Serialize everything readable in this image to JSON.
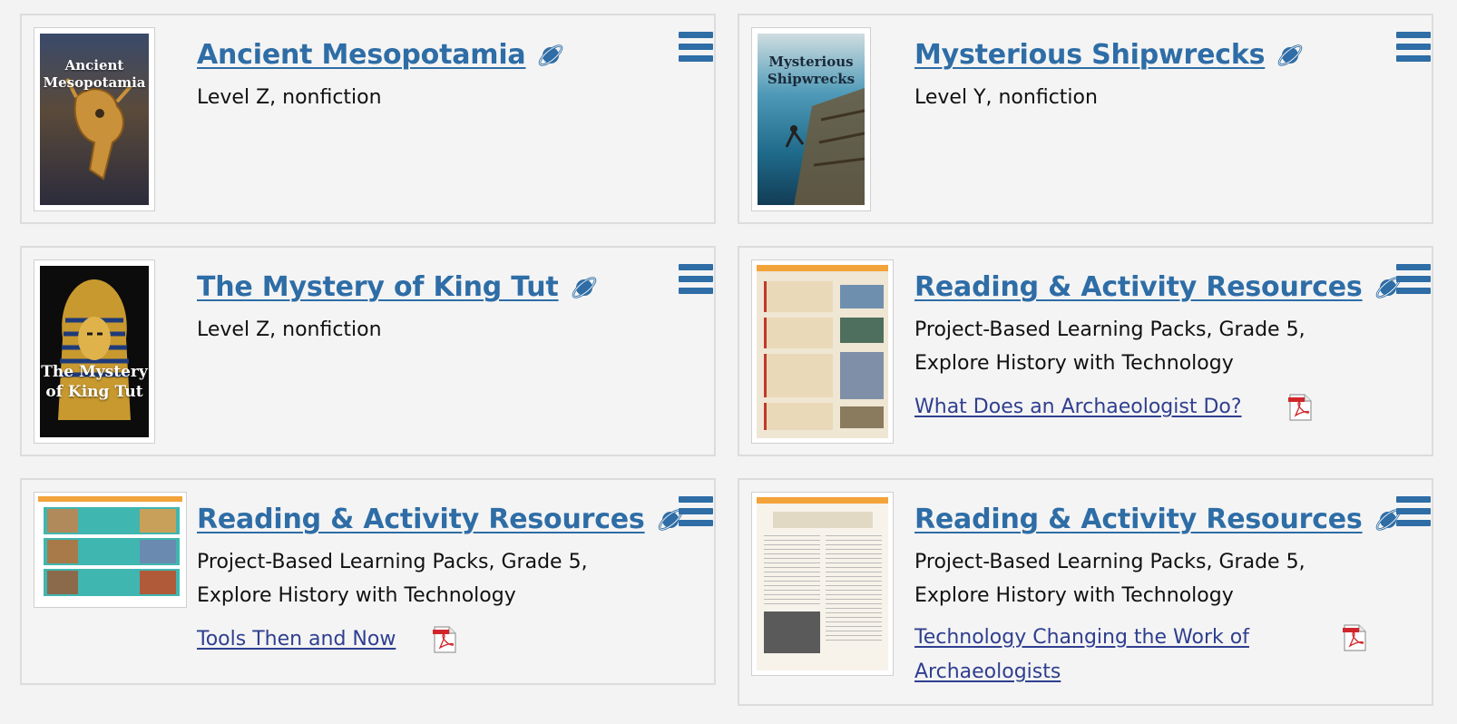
{
  "cards": [
    {
      "title": "Ancient Mesopotamia",
      "meta_line1": "Level Z, nonfiction",
      "cover_text": "Ancient Mesopotamia",
      "icons": {
        "explore": "planet-icon",
        "menu": "hamburger-menu-icon"
      }
    },
    {
      "title": "Mysterious Shipwrecks",
      "meta_line1": "Level Y, nonfiction",
      "cover_text": "Mysterious Shipwrecks",
      "icons": {
        "explore": "planet-icon",
        "menu": "hamburger-menu-icon"
      }
    },
    {
      "title": "The Mystery of King Tut",
      "meta_line1": "Level Z, nonfiction",
      "cover_text": "The Mystery of King Tut",
      "icons": {
        "explore": "planet-icon",
        "menu": "hamburger-menu-icon"
      }
    },
    {
      "title": "Reading & Activity Resources",
      "meta_line1": "Project-Based Learning Packs, Grade 5,",
      "meta_line2": "Explore History with Technology",
      "resource_link": "What Does an Archaeologist Do?",
      "icons": {
        "explore": "planet-icon",
        "menu": "hamburger-menu-icon",
        "file": "pdf-icon"
      }
    },
    {
      "title": "Reading & Activity Resources",
      "meta_line1": "Project-Based Learning Packs, Grade 5,",
      "meta_line2": "Explore History with Technology",
      "resource_link": "Tools Then and Now",
      "icons": {
        "explore": "planet-icon",
        "menu": "hamburger-menu-icon",
        "file": "pdf-icon"
      }
    },
    {
      "title": "Reading & Activity Resources",
      "meta_line1": "Project-Based Learning Packs, Grade 5,",
      "meta_line2": "Explore History with Technology",
      "resource_link_line1": "Technology Changing the Work of",
      "resource_link_line2": "Archaeologists",
      "icons": {
        "explore": "planet-icon",
        "menu": "hamburger-menu-icon",
        "file": "pdf-icon"
      }
    }
  ],
  "colors": {
    "title_link": "#2e6da6",
    "resource_link": "#2f3f8f",
    "menu": "#2e6da6",
    "pdf": "#d0262b"
  }
}
